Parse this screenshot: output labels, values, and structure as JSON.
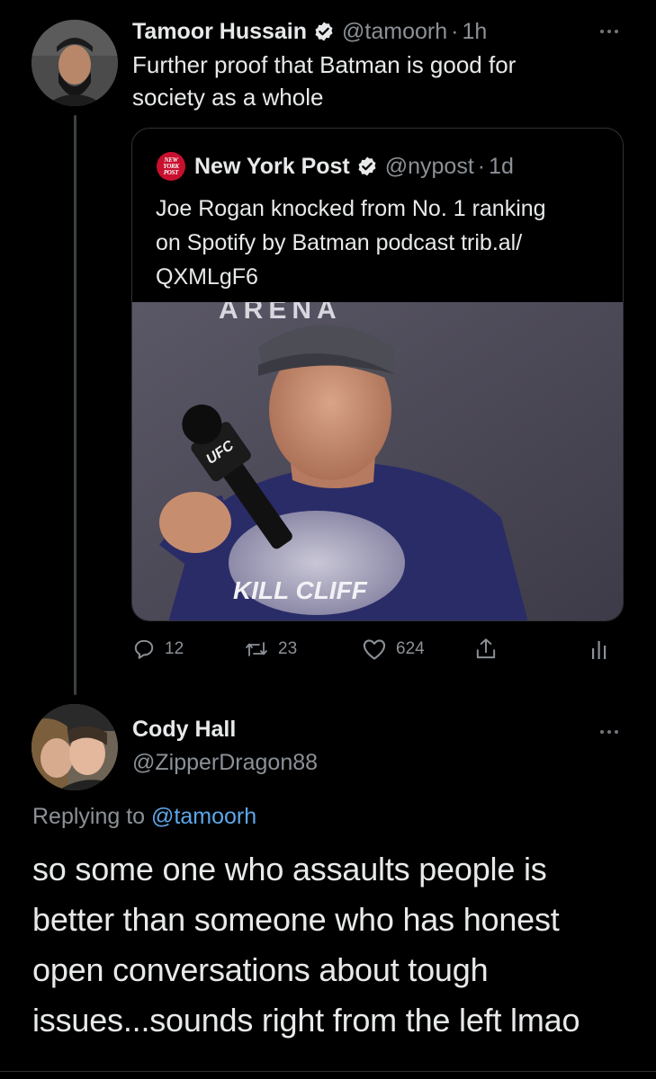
{
  "tweet": {
    "author_name": "Tamoor Hussain",
    "handle": "@tamoorh",
    "separator": "·",
    "time": "1h",
    "text": "Further proof that Batman is good for\nsociety as a whole",
    "verified": true,
    "quote": {
      "author_name": "New York Post",
      "logo_text": "NEW\nYORK\nPOST",
      "handle": "@nypost",
      "separator": "·",
      "time": "1d",
      "text": "Joe Rogan knocked from No. 1 ranking\non Spotify by Batman podcast trib.al/\nQXMLgF6",
      "verified": true,
      "photo": {
        "shirt_text": "KILL CLIFF",
        "mic_text": "UFC",
        "sign_text": "ARENA"
      }
    },
    "actions": {
      "replies": "12",
      "retweets": "23",
      "likes": "624"
    }
  },
  "reply": {
    "author_name": "Cody Hall",
    "handle": "@ZipperDragon88",
    "replying_prefix": "Replying to",
    "replying_handle": "@tamoorh",
    "text": "so some one who assaults people is\nbetter than someone who has honest\nopen conversations about tough\nissues...sounds right from the left lmao"
  },
  "colors": {
    "background": "#000000",
    "text": "#e7e9ea",
    "secondary": "#8b9197",
    "link": "#5ea6e9",
    "verified": "#e7e9ea",
    "nypost_red": "#c8102e"
  }
}
